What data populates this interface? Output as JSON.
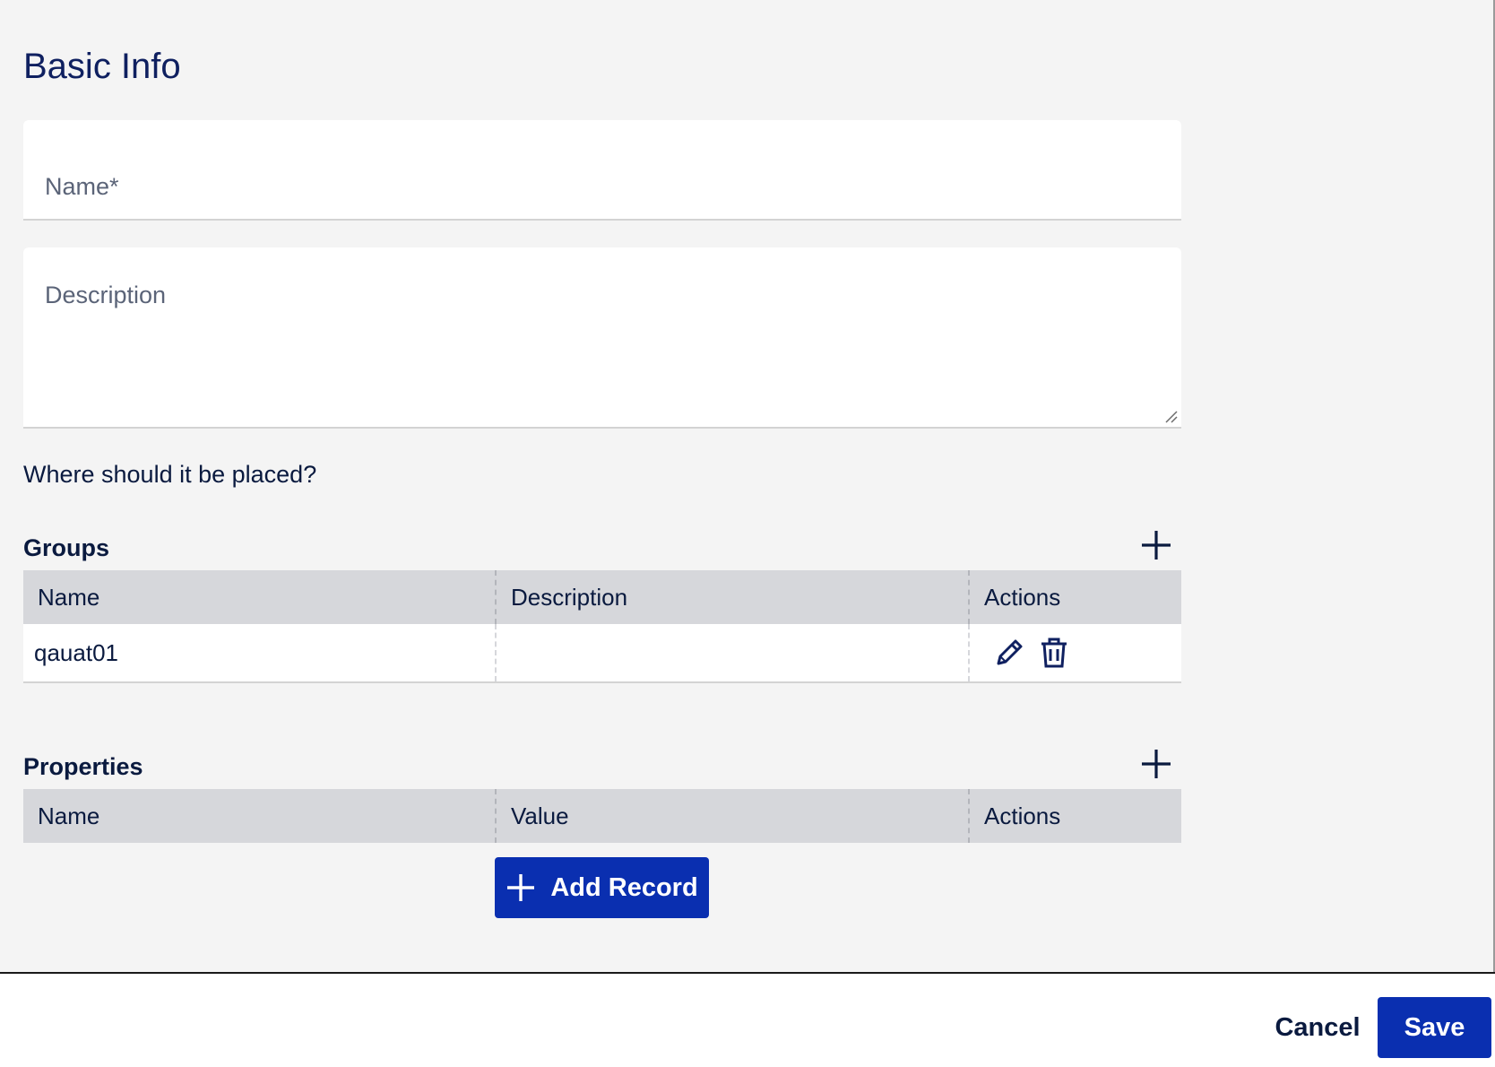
{
  "basic_info": {
    "title": "Basic Info",
    "name_placeholder": "Name*",
    "name_value": "",
    "description_placeholder": "Description",
    "description_value": ""
  },
  "placement": {
    "question": "Where should it be placed?"
  },
  "groups": {
    "title": "Groups",
    "add_icon": "plus-icon",
    "columns": [
      "Name",
      "Description",
      "Actions"
    ],
    "rows": [
      {
        "name": "qauat01",
        "description": "",
        "actions": [
          "pencil-icon",
          "trash-icon"
        ]
      }
    ]
  },
  "properties": {
    "title": "Properties",
    "add_icon": "plus-icon",
    "columns": [
      "Name",
      "Value",
      "Actions"
    ],
    "rows": [],
    "add_record_label": "Add Record"
  },
  "footer": {
    "cancel_label": "Cancel",
    "save_label": "Save"
  },
  "colors": {
    "primary": "#0a2fb0",
    "heading": "#0f2060",
    "table_header_bg": "#d6d7db",
    "page_bg": "#f4f4f4"
  }
}
